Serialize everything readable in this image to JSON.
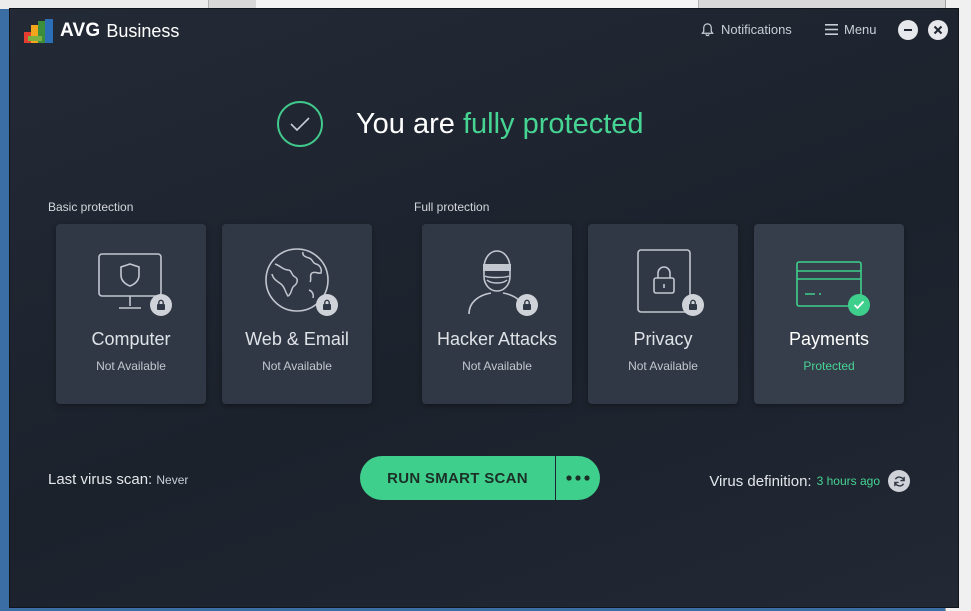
{
  "app": {
    "brand": "AVG",
    "product": "Business"
  },
  "titlebar": {
    "notifications_label": "Notifications",
    "menu_label": "Menu"
  },
  "hero": {
    "prefix": "You are ",
    "highlight": "fully protected"
  },
  "sections": {
    "basic_label": "Basic protection",
    "full_label": "Full protection"
  },
  "cards": [
    {
      "title": "Computer",
      "status": "Not Available",
      "icon": "computer-shield-icon",
      "locked": true
    },
    {
      "title": "Web & Email",
      "status": "Not Available",
      "icon": "globe-icon",
      "locked": true
    },
    {
      "title": "Hacker Attacks",
      "status": "Not Available",
      "icon": "hacker-icon",
      "locked": true
    },
    {
      "title": "Privacy",
      "status": "Not Available",
      "icon": "privacy-lock-icon",
      "locked": true
    },
    {
      "title": "Payments",
      "status": "Protected",
      "icon": "credit-card-icon",
      "locked": false
    }
  ],
  "scan": {
    "last_label": "Last virus scan:",
    "last_value": "Never",
    "button_label": "RUN SMART SCAN"
  },
  "definitions": {
    "label": "Virus definition:",
    "value": "3 hours ago"
  },
  "colors": {
    "accent": "#3fcf8c",
    "window_bg": "#1f2530",
    "card_bg": "#313845"
  }
}
